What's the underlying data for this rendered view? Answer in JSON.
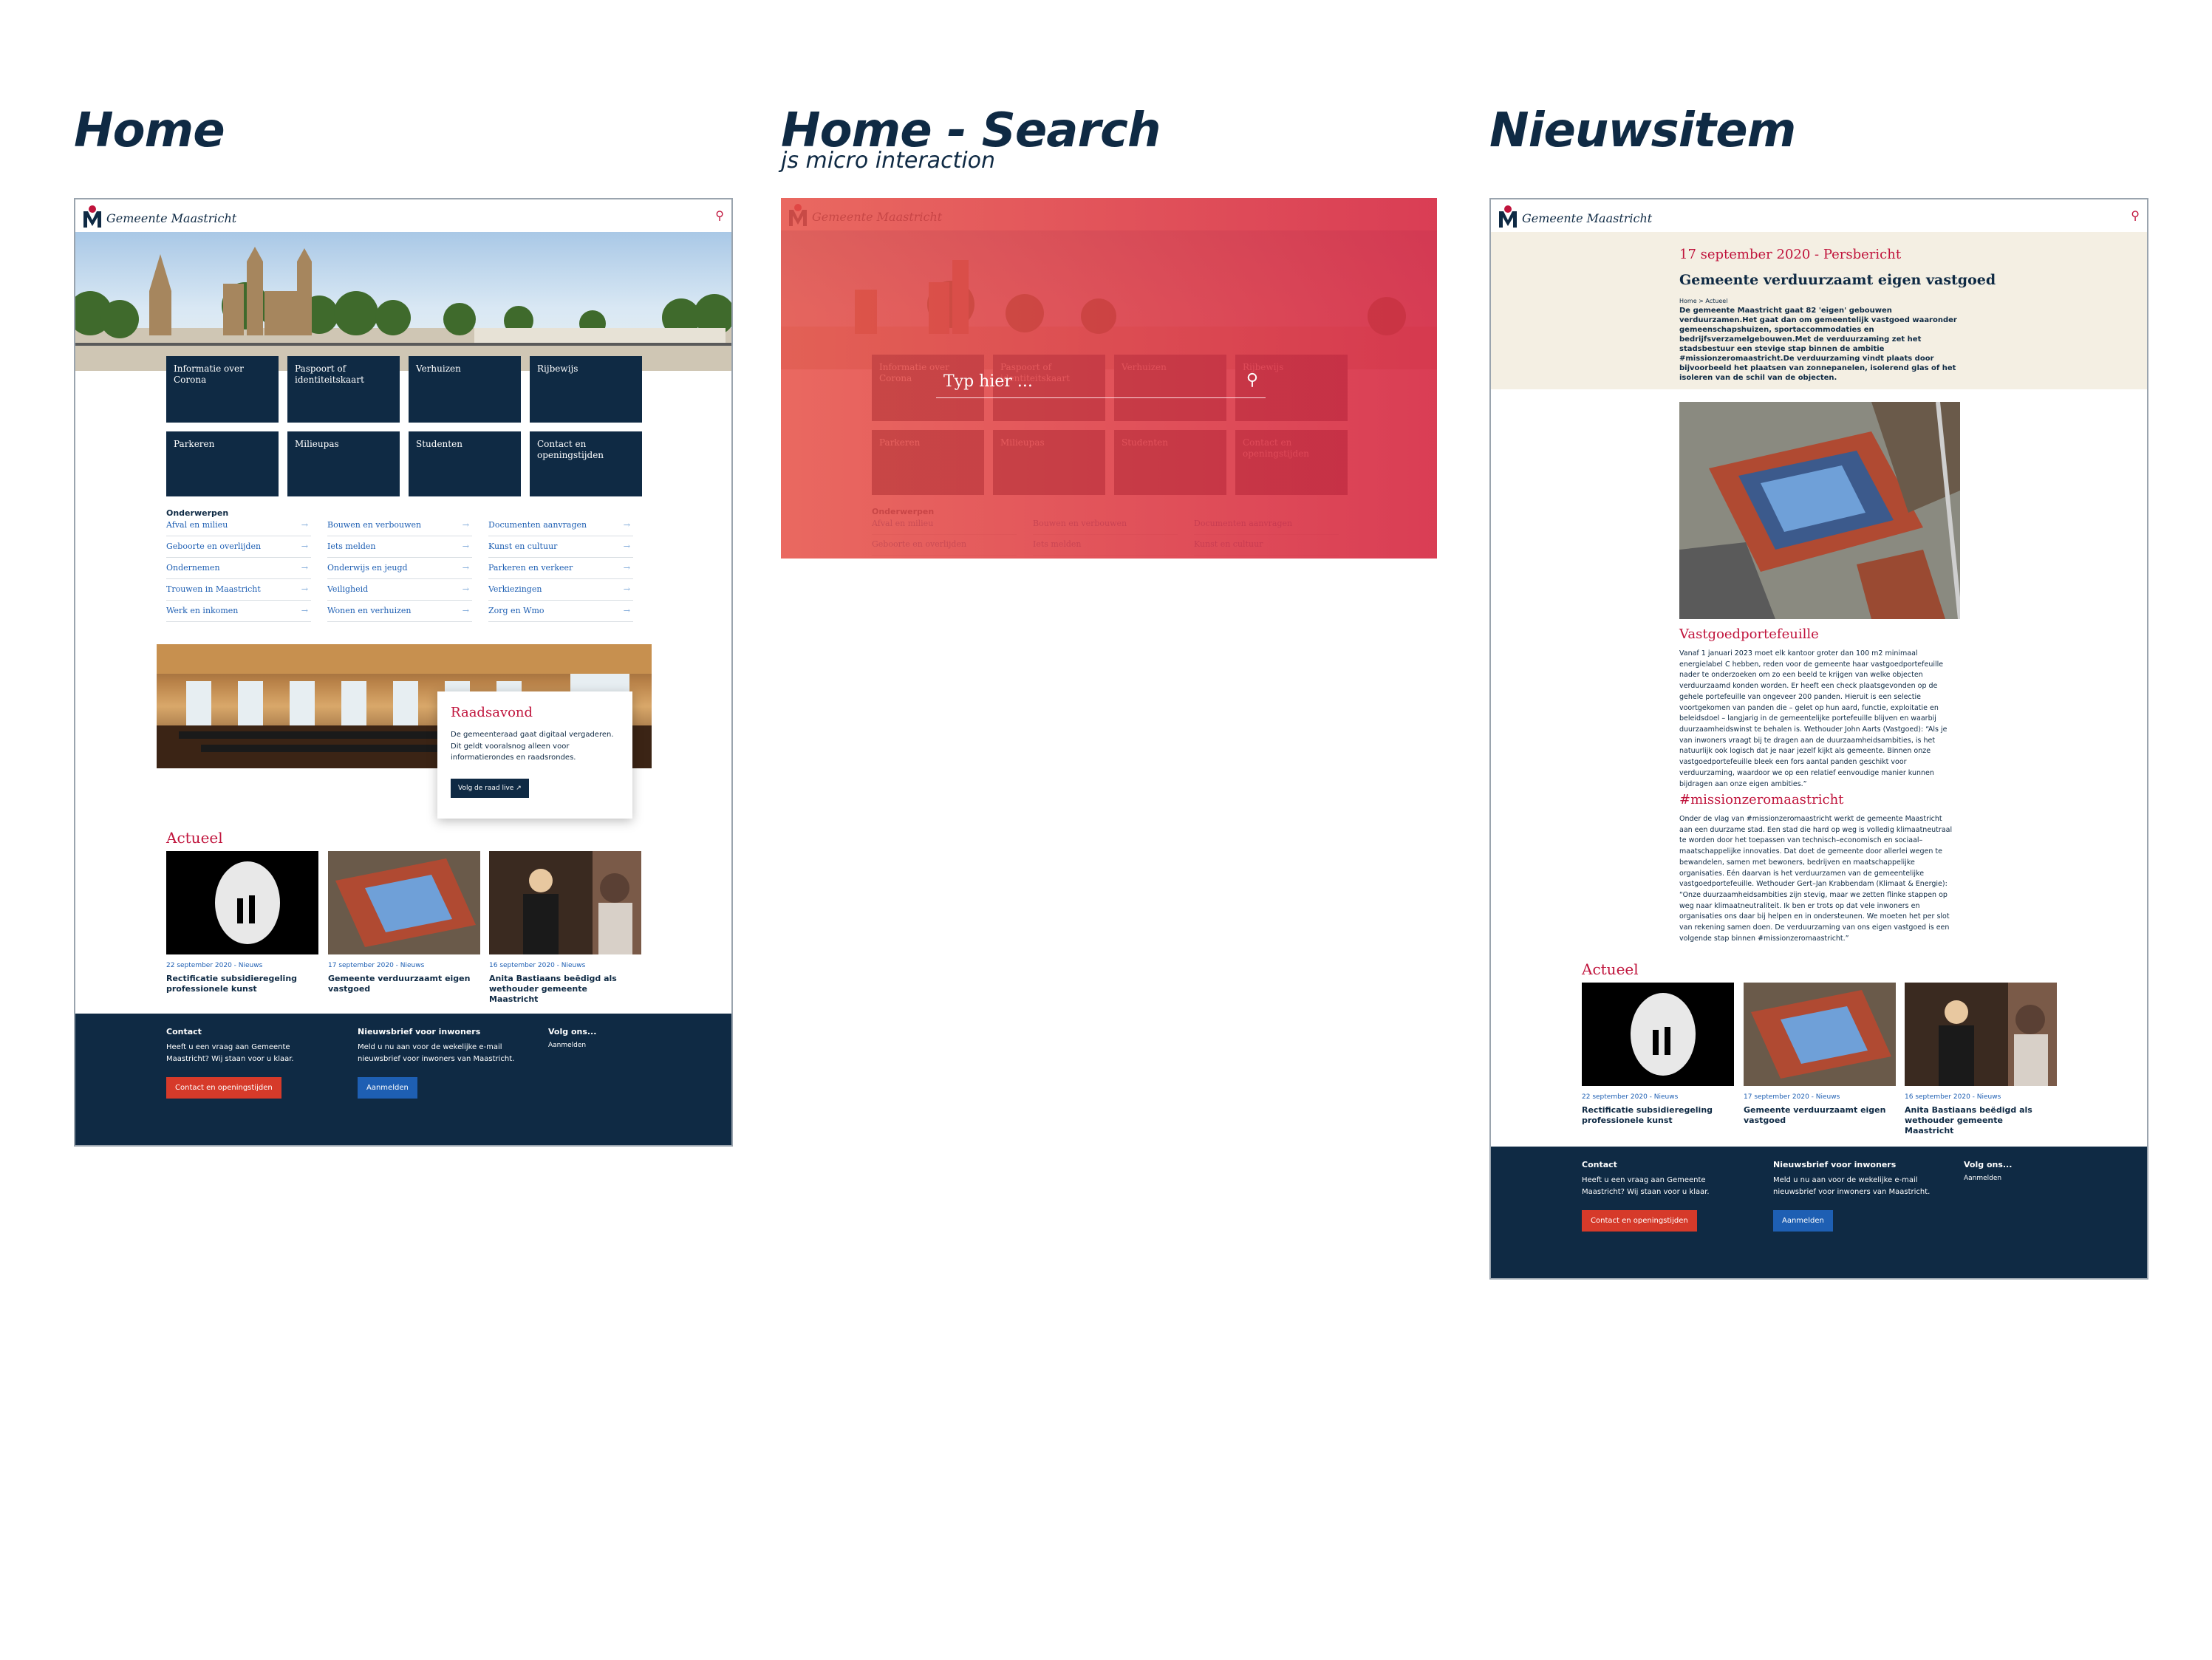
{
  "sections": {
    "home": "Home",
    "search": "Home - Search",
    "search_sub": "js micro interaction",
    "news": "Nieuwsitem"
  },
  "brand": {
    "name": "Gemeente Maastricht"
  },
  "home": {
    "tiles": [
      "Informatie over Corona",
      "Paspoort of identiteitskaart",
      "Verhuizen",
      "Rijbewijs",
      "Parkeren",
      "Milieupas",
      "Studenten",
      "Contact en openingstijden"
    ],
    "subjects_heading": "Onderwerpen",
    "subjects": [
      [
        "Afval en milieu",
        "Bouwen en verbouwen",
        "Documenten aanvragen"
      ],
      [
        "Geboorte en overlijden",
        "Iets melden",
        "Kunst en cultuur"
      ],
      [
        "Ondernemen",
        "Onderwijs en jeugd",
        "Parkeren en verkeer"
      ],
      [
        "Trouwen in Maastricht",
        "Veiligheid",
        "Verkiezingen"
      ],
      [
        "Werk en inkomen",
        "Wonen en verhuizen",
        "Zorg en Wmo"
      ]
    ],
    "raad": {
      "title": "Raadsavond",
      "text": "De gemeenteraad gaat digitaal vergaderen. Dit geldt vooralsnog alleen voor informatierondes en raadsrondes.",
      "button": "Volg de raad live"
    }
  },
  "actueel": {
    "heading": "Actueel",
    "items": [
      {
        "date": "22 september 2020 - Nieuws",
        "title": "Rectificatie subsidieregeling professionele kunst"
      },
      {
        "date": "17 september 2020 - Nieuws",
        "title": "Gemeente verduurzaamt eigen vastgoed"
      },
      {
        "date": "16 september 2020 - Nieuws",
        "title": "Anita Bastiaans beëdigd als wethouder gemeente Maastricht"
      }
    ]
  },
  "footer": {
    "contact_h": "Contact",
    "contact_t": "Heeft u een vraag aan Gemeente Maastricht? Wij staan voor u klaar.",
    "contact_btn": "Contact en openingstijden",
    "news_h": "Nieuwsbrief voor inwoners",
    "news_t": "Meld u nu aan voor de wekelijke e-mail nieuwsbrief voor inwoners van Maastricht.",
    "news_btn": "Aanmelden",
    "follow_h": "Volg ons...",
    "follow_t": "Aanmelden"
  },
  "search": {
    "placeholder": "Typ hier ..."
  },
  "newsitem": {
    "date": "17 september 2020 - Persbericht",
    "title": "Gemeente verduurzaamt eigen vastgoed",
    "crumb": "Home > Actueel",
    "lead": "De gemeente Maastricht gaat 82 'eigen' gebouwen verduurzamen.Het gaat dan om gemeentelijk vastgoed waaronder gemeenschapshuizen, sportaccommodaties en bedrijfsverzamelgebouwen.Met de verduurzaming zet het stadsbestuur een stevige stap binnen de ambitie #missionzeromaastricht.De verduurzaming vindt plaats door bijvoorbeeld het plaatsen van zonnepanelen, isolerend glas of het isoleren van de schil van de objecten.",
    "h1": "Vastgoedportefeuille",
    "p1": "Vanaf 1 januari 2023 moet elk kantoor groter dan 100 m2 minimaal energielabel C hebben, reden voor de gemeente haar vastgoedportefeuille nader te onderzoeken om zo een beeld te krijgen van welke objecten verduurzaamd konden worden. Er heeft een check plaatsgevonden op de gehele portefeuille van ongeveer 200 panden. Hieruit is een selectie voortgekomen van panden die – gelet op hun aard, functie, exploitatie en beleidsdoel – langjarig in de gemeentelijke portefeuille blijven en waarbij duurzaamheidswinst te behalen is. Wethouder John Aarts (Vastgoed): “Als je van inwoners vraagt bij te dragen aan de duurzaamheidsambities, is het natuurlijk ook logisch dat je naar jezelf kijkt als gemeente. Binnen onze vastgoedportefeuille bleek een fors aantal panden geschikt voor verduurzaming, waardoor we op een relatief eenvoudige manier kunnen bijdragen aan onze eigen ambities.”",
    "h2": "#missionzeromaastricht",
    "p2": "Onder de vlag van #missionzeromaastricht werkt de gemeente Maastricht aan een duurzame stad. Een stad die hard op weg is volledig klimaatneutraal te worden door het toepassen van technisch–economisch en sociaal–maatschappelijke innovaties. Dat doet de gemeente door allerlei wegen te bewandelen, samen met bewoners, bedrijven en maatschappelijke organisaties. Eén daarvan is het verduurzamen van de gemeentelijke vastgoedportefeuille. Wethouder Gert–Jan Krabbendam (Klimaat & Energie): “Onze duurzaamheidsambities zijn stevig, maar we zetten flinke stappen op weg naar klimaatneutraliteit. Ik ben er trots op dat vele inwoners en organisaties ons daar bij helpen en in ondersteunen. We moeten het per slot van rekening samen doen. De verduurzaming van ons eigen vastgoed is een volgende stap binnen #missionzeromaastricht.”"
  }
}
